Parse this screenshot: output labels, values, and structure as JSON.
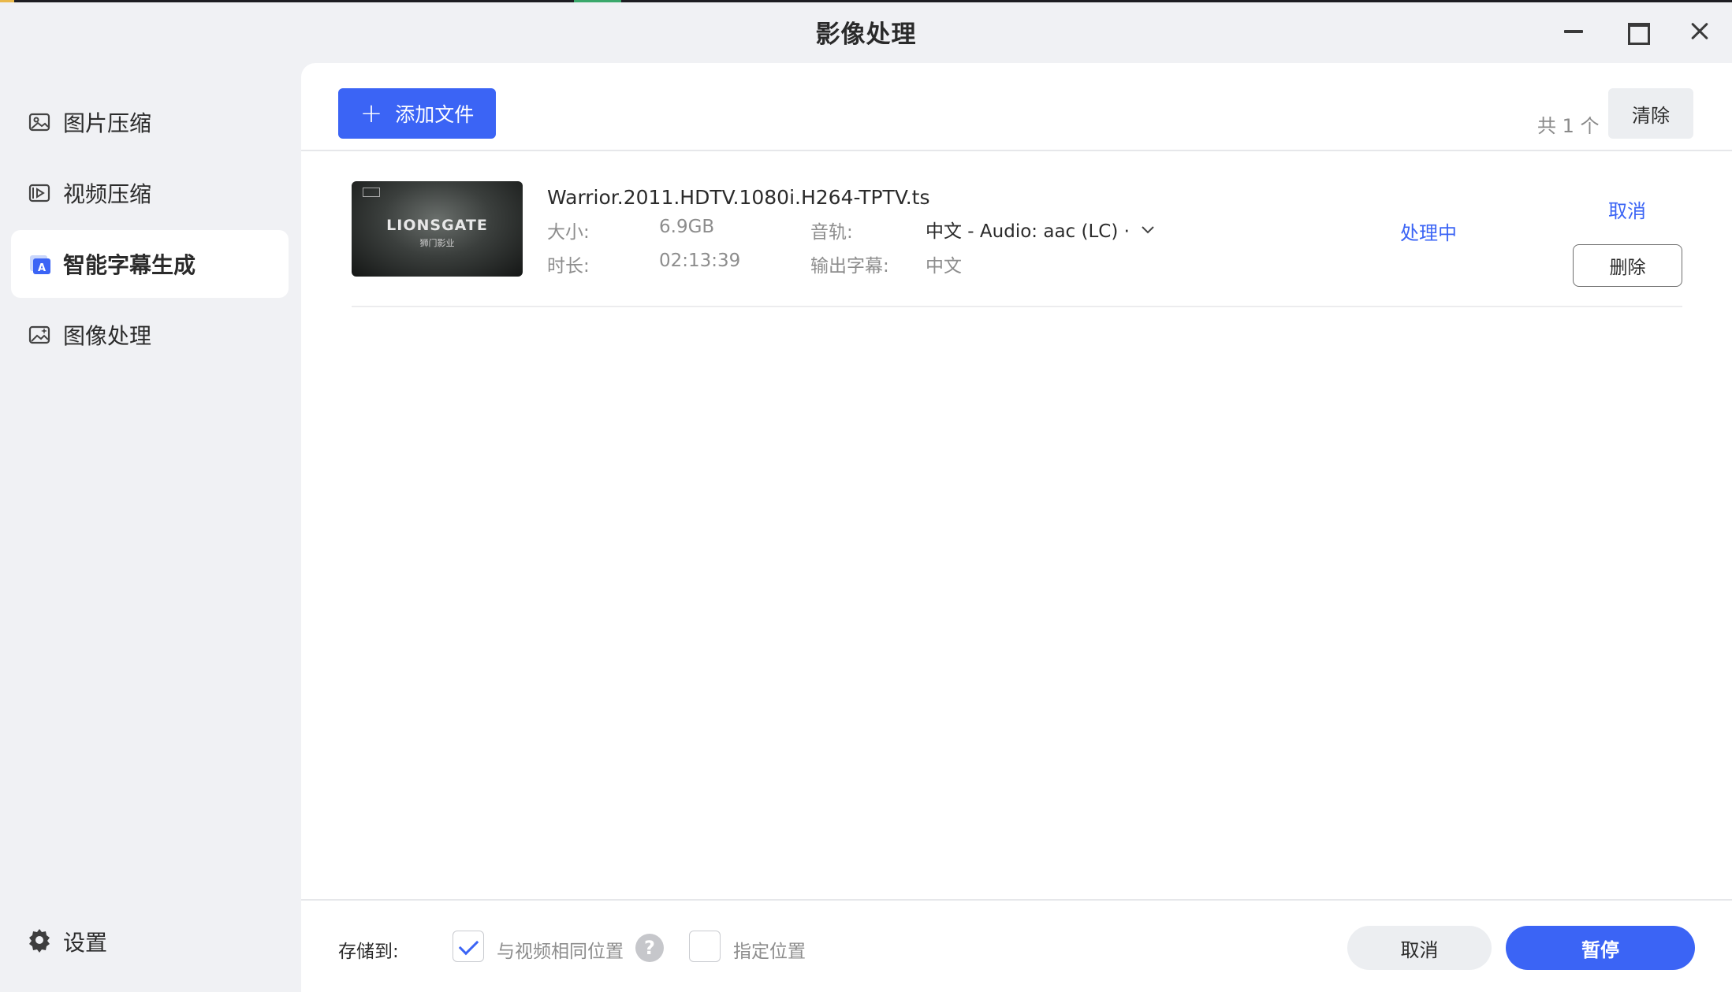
{
  "window": {
    "title": "影像处理"
  },
  "sidebar": {
    "items": [
      {
        "label": "图片压缩",
        "icon": "image-compress-icon"
      },
      {
        "label": "视频压缩",
        "icon": "video-compress-icon"
      },
      {
        "label": "智能字幕生成",
        "icon": "subtitle-icon",
        "active": true
      },
      {
        "label": "图像处理",
        "icon": "image-process-icon"
      }
    ],
    "settings_label": "设置"
  },
  "toolbar": {
    "add_file_label": "添加文件",
    "count_text": "共 1 个",
    "clear_label": "清除"
  },
  "files": [
    {
      "thumbnail_text": "LIONSGATE",
      "thumbnail_subtext": "狮门影业",
      "name": "Warrior.2011.HDTV.1080i.H264-TPTV.ts",
      "size_label": "大小:",
      "size_value": "6.9GB",
      "duration_label": "时长:",
      "duration_value": "02:13:39",
      "audio_label": "音轨:",
      "audio_value": "中文 - Audio: aac (LC) ·",
      "subtitle_label": "输出字幕:",
      "subtitle_value": "中文",
      "status": "处理中",
      "cancel_label": "取消",
      "delete_label": "删除"
    }
  ],
  "footer": {
    "save_to_label": "存储到:",
    "same_location_label": "与视频相同位置",
    "same_location_checked": true,
    "custom_location_label": "指定位置",
    "custom_location_checked": false,
    "cancel_label": "取消",
    "pause_label": "暂停"
  },
  "colors": {
    "accent": "#3b64f5",
    "sidebar_bg": "#f0f1f4",
    "panel_bg": "#ffffff"
  }
}
